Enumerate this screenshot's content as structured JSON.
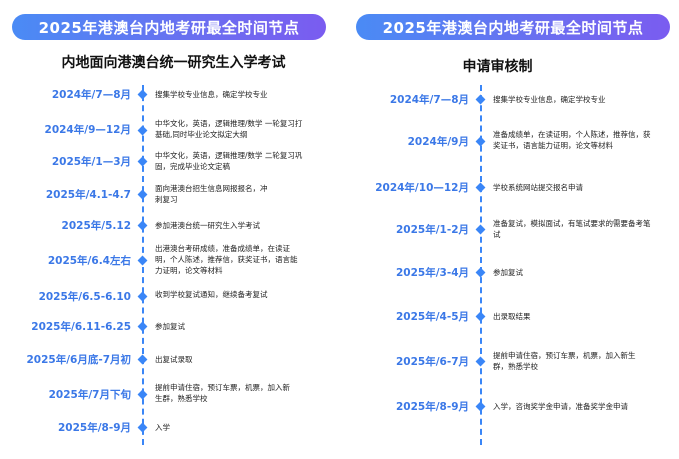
{
  "left": {
    "banner": "2025年港澳台内地考研最全时间节点",
    "subtitle": "内地面向港澳台统一研究生入学考试",
    "items": [
      {
        "date": "2024年/7—8月",
        "desc": "搜集学校专业信息，确定学校专业"
      },
      {
        "date": "2024年/9—12月",
        "desc": "中华文化，英语，逻辑推理/数学 一轮复习打基础,同时毕业论文拟定大纲"
      },
      {
        "date": "2025年/1—3月",
        "desc": "中华文化，英语，逻辑推理/数学 二轮复习巩固，完成毕业论文定稿"
      },
      {
        "date": "2025年/4.1-4.7",
        "desc": "面向港澳台招生信息网报报名，冲刺复习"
      },
      {
        "date": "2025年/5.12",
        "desc": "参加港澳台统一研究生入学考试"
      },
      {
        "date": "2025年/6.4左右",
        "desc": "出港澳台考研成绩，准备成绩单，在读证明，个人陈述，推荐信，获奖证书，语言能力证明，论文等材料"
      },
      {
        "date": "2025年/6.5-6.10",
        "desc": "收到学校复试通知，继续备考复试"
      },
      {
        "date": "2025年/6.11-6.25",
        "desc": "参加复试"
      },
      {
        "date": "2025年/6月底-7月初",
        "desc": "出复试录取"
      },
      {
        "date": "2025年/7月下旬",
        "desc": "提前申请住宿，预订车票，机票，加入新生群，熟悉学校"
      },
      {
        "date": "2025年/8-9月",
        "desc": "入学"
      }
    ]
  },
  "right": {
    "banner": "2025年港澳台内地考研最全时间节点",
    "subtitle": "申请审核制",
    "items": [
      {
        "date": "2024年/7—8月",
        "desc": "搜集学校专业信息，确定学校专业"
      },
      {
        "date": "2024年/9月",
        "desc": "准备成绩单，在读证明，个人陈述，推荐信，获奖证书，语言能力证明，论文等材料"
      },
      {
        "date": "2024年/10—12月",
        "desc": "学校系统网站提交报名申请"
      },
      {
        "date": "2025年/1-2月",
        "desc": "准备复试，模拟面试，有笔试要求的需要备考笔试"
      },
      {
        "date": "2025年/3-4月",
        "desc": "参加复试"
      },
      {
        "date": "2025年/4-5月",
        "desc": "出录取结果"
      },
      {
        "date": "2025年/6-7月",
        "desc": "提前申请住宿，预订车票，机票，加入新生群，熟悉学校"
      },
      {
        "date": "2025年/8-9月",
        "desc": "入学，咨询奖学金申请，准备奖学金申请"
      }
    ]
  }
}
